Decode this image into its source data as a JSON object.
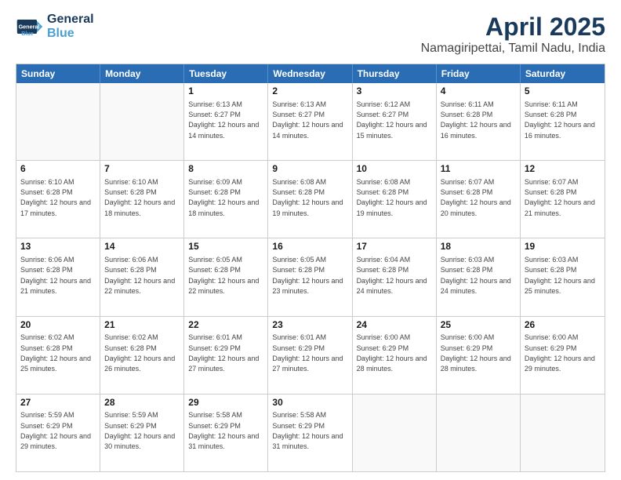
{
  "header": {
    "logo_line1": "General",
    "logo_line2": "Blue",
    "title": "April 2025",
    "subtitle": "Namagiripettai, Tamil Nadu, India"
  },
  "days": [
    "Sunday",
    "Monday",
    "Tuesday",
    "Wednesday",
    "Thursday",
    "Friday",
    "Saturday"
  ],
  "weeks": [
    [
      {
        "day": "",
        "info": ""
      },
      {
        "day": "",
        "info": ""
      },
      {
        "day": "1",
        "info": "Sunrise: 6:13 AM\nSunset: 6:27 PM\nDaylight: 12 hours and 14 minutes."
      },
      {
        "day": "2",
        "info": "Sunrise: 6:13 AM\nSunset: 6:27 PM\nDaylight: 12 hours and 14 minutes."
      },
      {
        "day": "3",
        "info": "Sunrise: 6:12 AM\nSunset: 6:27 PM\nDaylight: 12 hours and 15 minutes."
      },
      {
        "day": "4",
        "info": "Sunrise: 6:11 AM\nSunset: 6:28 PM\nDaylight: 12 hours and 16 minutes."
      },
      {
        "day": "5",
        "info": "Sunrise: 6:11 AM\nSunset: 6:28 PM\nDaylight: 12 hours and 16 minutes."
      }
    ],
    [
      {
        "day": "6",
        "info": "Sunrise: 6:10 AM\nSunset: 6:28 PM\nDaylight: 12 hours and 17 minutes."
      },
      {
        "day": "7",
        "info": "Sunrise: 6:10 AM\nSunset: 6:28 PM\nDaylight: 12 hours and 18 minutes."
      },
      {
        "day": "8",
        "info": "Sunrise: 6:09 AM\nSunset: 6:28 PM\nDaylight: 12 hours and 18 minutes."
      },
      {
        "day": "9",
        "info": "Sunrise: 6:08 AM\nSunset: 6:28 PM\nDaylight: 12 hours and 19 minutes."
      },
      {
        "day": "10",
        "info": "Sunrise: 6:08 AM\nSunset: 6:28 PM\nDaylight: 12 hours and 19 minutes."
      },
      {
        "day": "11",
        "info": "Sunrise: 6:07 AM\nSunset: 6:28 PM\nDaylight: 12 hours and 20 minutes."
      },
      {
        "day": "12",
        "info": "Sunrise: 6:07 AM\nSunset: 6:28 PM\nDaylight: 12 hours and 21 minutes."
      }
    ],
    [
      {
        "day": "13",
        "info": "Sunrise: 6:06 AM\nSunset: 6:28 PM\nDaylight: 12 hours and 21 minutes."
      },
      {
        "day": "14",
        "info": "Sunrise: 6:06 AM\nSunset: 6:28 PM\nDaylight: 12 hours and 22 minutes."
      },
      {
        "day": "15",
        "info": "Sunrise: 6:05 AM\nSunset: 6:28 PM\nDaylight: 12 hours and 22 minutes."
      },
      {
        "day": "16",
        "info": "Sunrise: 6:05 AM\nSunset: 6:28 PM\nDaylight: 12 hours and 23 minutes."
      },
      {
        "day": "17",
        "info": "Sunrise: 6:04 AM\nSunset: 6:28 PM\nDaylight: 12 hours and 24 minutes."
      },
      {
        "day": "18",
        "info": "Sunrise: 6:03 AM\nSunset: 6:28 PM\nDaylight: 12 hours and 24 minutes."
      },
      {
        "day": "19",
        "info": "Sunrise: 6:03 AM\nSunset: 6:28 PM\nDaylight: 12 hours and 25 minutes."
      }
    ],
    [
      {
        "day": "20",
        "info": "Sunrise: 6:02 AM\nSunset: 6:28 PM\nDaylight: 12 hours and 25 minutes."
      },
      {
        "day": "21",
        "info": "Sunrise: 6:02 AM\nSunset: 6:28 PM\nDaylight: 12 hours and 26 minutes."
      },
      {
        "day": "22",
        "info": "Sunrise: 6:01 AM\nSunset: 6:29 PM\nDaylight: 12 hours and 27 minutes."
      },
      {
        "day": "23",
        "info": "Sunrise: 6:01 AM\nSunset: 6:29 PM\nDaylight: 12 hours and 27 minutes."
      },
      {
        "day": "24",
        "info": "Sunrise: 6:00 AM\nSunset: 6:29 PM\nDaylight: 12 hours and 28 minutes."
      },
      {
        "day": "25",
        "info": "Sunrise: 6:00 AM\nSunset: 6:29 PM\nDaylight: 12 hours and 28 minutes."
      },
      {
        "day": "26",
        "info": "Sunrise: 6:00 AM\nSunset: 6:29 PM\nDaylight: 12 hours and 29 minutes."
      }
    ],
    [
      {
        "day": "27",
        "info": "Sunrise: 5:59 AM\nSunset: 6:29 PM\nDaylight: 12 hours and 29 minutes."
      },
      {
        "day": "28",
        "info": "Sunrise: 5:59 AM\nSunset: 6:29 PM\nDaylight: 12 hours and 30 minutes."
      },
      {
        "day": "29",
        "info": "Sunrise: 5:58 AM\nSunset: 6:29 PM\nDaylight: 12 hours and 31 minutes."
      },
      {
        "day": "30",
        "info": "Sunrise: 5:58 AM\nSunset: 6:29 PM\nDaylight: 12 hours and 31 minutes."
      },
      {
        "day": "",
        "info": ""
      },
      {
        "day": "",
        "info": ""
      },
      {
        "day": "",
        "info": ""
      }
    ]
  ]
}
